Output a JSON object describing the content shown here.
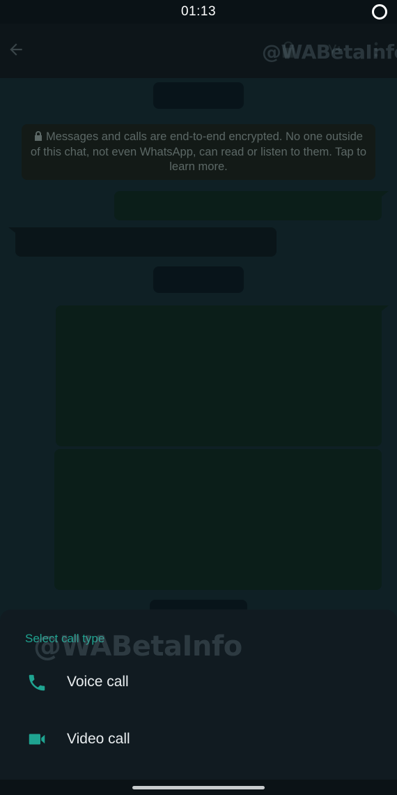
{
  "status_bar": {
    "time": "01:13"
  },
  "watermark": "@WABetaInfo",
  "chat": {
    "encryption_notice": "Messages and calls are end-to-end encrypted. No one outside of this chat, not even WhatsApp, can read or listen to them. Tap to learn more."
  },
  "sheet": {
    "title": "Select call type",
    "options": [
      {
        "label": "Voice call",
        "icon": "phone-icon"
      },
      {
        "label": "Video call",
        "icon": "video-camera-icon"
      }
    ]
  },
  "colors": {
    "accent": "#1fa491",
    "sheet_background": "#111b21",
    "chat_background": "#0f2025"
  }
}
